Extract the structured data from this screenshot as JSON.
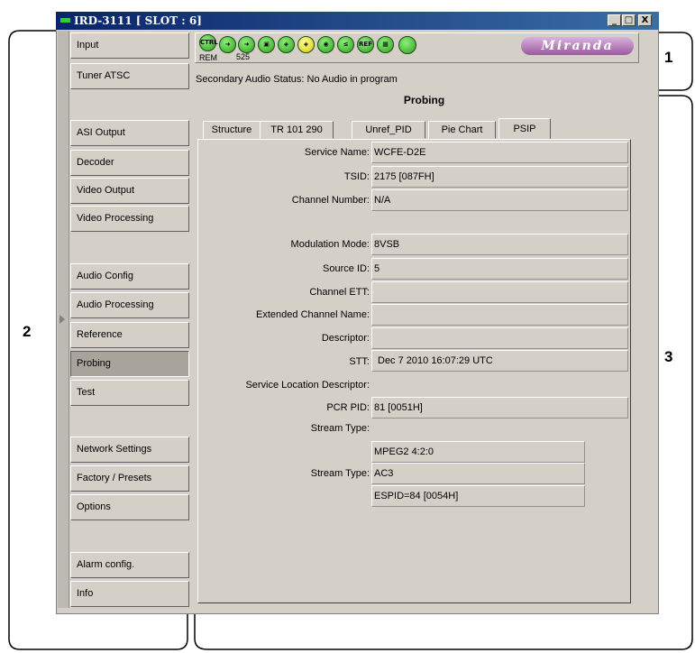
{
  "callouts": [
    "1",
    "2",
    "3"
  ],
  "window": {
    "title": "IRD-3111 [ SLOT : 6]",
    "minimize": "_",
    "maximize": "□",
    "close": "X"
  },
  "sidebar": {
    "items": [
      {
        "label": "Input"
      },
      {
        "label": "Tuner ATSC"
      },
      {
        "label": "ASI Output"
      },
      {
        "label": "Decoder"
      },
      {
        "label": "Video Output"
      },
      {
        "label": "Video Processing"
      },
      {
        "label": "Audio Config"
      },
      {
        "label": "Audio Processing"
      },
      {
        "label": "Reference"
      },
      {
        "label": "Probing",
        "active": true
      },
      {
        "label": "Test"
      },
      {
        "label": "Network Settings"
      },
      {
        "label": "Factory / Presets"
      },
      {
        "label": "Options"
      },
      {
        "label": "Alarm config."
      },
      {
        "label": "Info"
      }
    ]
  },
  "iconbar": {
    "ctrl": "CTRL",
    "rem": "REM",
    "num": "525",
    "ref": "REF",
    "logo": "Miranda"
  },
  "status": {
    "secondary_audio": "Secondary Audio Status: No Audio in program"
  },
  "panel_title": "Probing",
  "tabs": [
    "Structure",
    "TR 101 290",
    "Unref_PID",
    "Pie Chart",
    "PSIP"
  ],
  "active_tab": "PSIP",
  "psip": {
    "service_name": {
      "label": "Service Name:",
      "value": "WCFE-D2E"
    },
    "tsid": {
      "label": "TSID:",
      "value": "2175 [087FH]"
    },
    "channel_number": {
      "label": "Channel Number:",
      "value": "N/A"
    },
    "modulation_mode": {
      "label": "Modulation Mode:",
      "value": "8VSB"
    },
    "source_id": {
      "label": "Source ID:",
      "value": "5"
    },
    "channel_ett": {
      "label": "Channel ETT:",
      "value": ""
    },
    "extended_channel_name": {
      "label": "Extended Channel Name:",
      "value": ""
    },
    "descriptor": {
      "label": "Descriptor:",
      "value": ""
    },
    "stt": {
      "label": "STT:",
      "value": "Dec 7 2010 16:07:29 UTC"
    },
    "service_location": {
      "label": "Service Location Descriptor:"
    },
    "pcr_pid": {
      "label": "PCR PID:",
      "value": "81 [0051H]"
    },
    "stream_type_1": {
      "label": "Stream Type:",
      "value": "MPEG2 4:2:0"
    },
    "stream_type_2": {
      "label": "Stream Type:",
      "value": "AC3"
    },
    "espid": {
      "value": "ESPID=84 [0054H]"
    }
  }
}
